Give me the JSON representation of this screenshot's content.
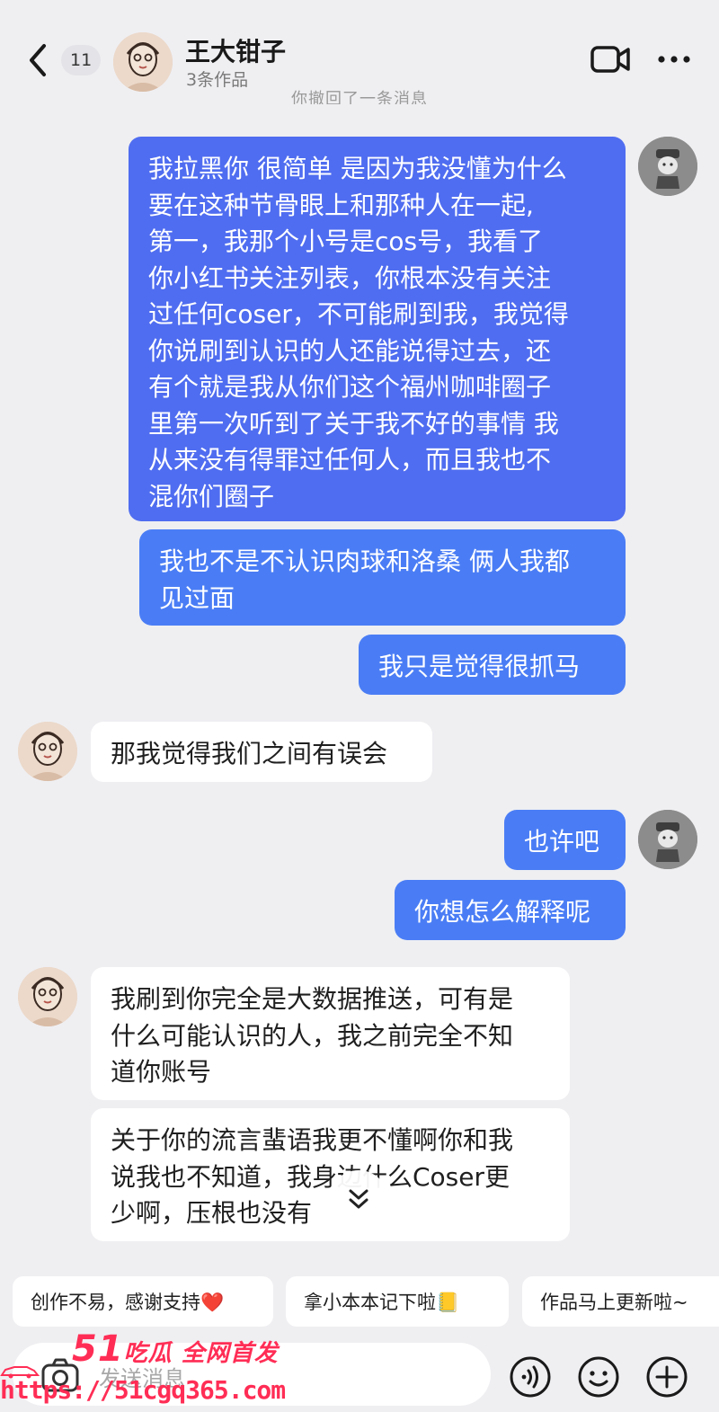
{
  "header": {
    "unread_count": "11",
    "name": "王大钳子",
    "subtitle": "3条作品"
  },
  "retract_note": "你撤回了一条消息",
  "messages": [
    {
      "side": "me",
      "lines": [
        "我拉黑你 很简单 是因为我没懂为什么",
        "要在这种节骨眼上和那种人在一起,",
        "第一，我那个小号是cos号，我看了",
        "你小红书关注列表，你根本没有关注",
        "过任何coser，不可能刷到我，我觉得",
        "你说刷到认识的人还能说得过去，还",
        "有个就是我从你们这个福州咖啡圈子",
        "里第一次听到了关于我不好的事情 我",
        "从来没有得罪过任何人，而且我也不",
        "混你们圈子"
      ]
    },
    {
      "side": "me",
      "lines": [
        "我也不是不认识肉球和洛桑 俩人我都",
        "见过面"
      ]
    },
    {
      "side": "me",
      "lines": [
        "我只是觉得很抓马"
      ]
    },
    {
      "side": "them",
      "lines": [
        "那我觉得我们之间有误会"
      ]
    },
    {
      "side": "me",
      "lines": [
        "也许吧"
      ]
    },
    {
      "side": "me",
      "lines": [
        "你想怎么解释呢"
      ]
    },
    {
      "side": "them",
      "lines": [
        "我刷到你完全是大数据推送，可有是",
        "什么可能认识的人，我之前完全不知",
        "道你账号"
      ]
    },
    {
      "side": "them",
      "lines": [
        "关于你的流言蜚语我更不懂啊你和我",
        "说我也不知道，我身边什么Coser更",
        "少啊，压根也没有"
      ]
    }
  ],
  "quick_replies": [
    "创作不易，感谢支持❤️",
    "拿小本本记下啦📒",
    "作品马上更新啦~"
  ],
  "input": {
    "placeholder": "发送消息"
  },
  "watermark": {
    "brand_number": "51",
    "brand_text": "吃瓜 全网首发",
    "url": "https://51cgq365.com"
  },
  "colors": {
    "my_bubble": "#4a7df5",
    "their_bubble": "#ffffff",
    "background": "#efeff2",
    "watermark": "#ff2d55"
  }
}
